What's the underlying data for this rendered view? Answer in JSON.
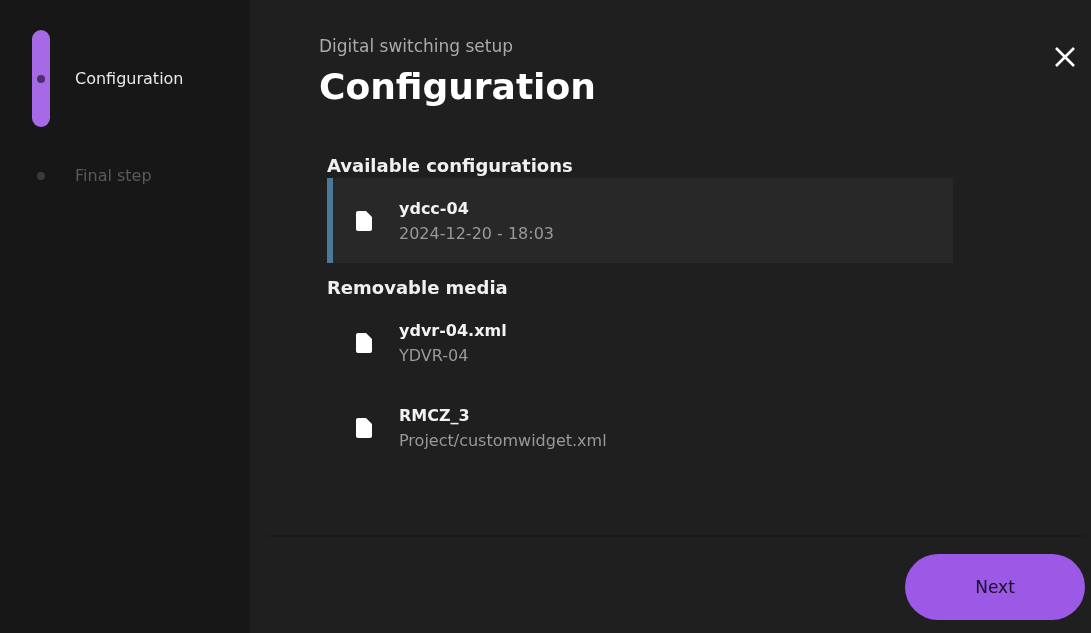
{
  "steps": [
    {
      "label": "Configuration",
      "selected": true
    },
    {
      "label": "Final step",
      "selected": false
    }
  ],
  "header": {
    "subtitle": "Digital switching setup",
    "title": "Configuration"
  },
  "sections": [
    {
      "title": "Available configurations",
      "items": [
        {
          "name": "ydcc-04",
          "detail": "2024-12-20 - 18:03",
          "selected": true
        }
      ]
    },
    {
      "title": "Removable media",
      "items": [
        {
          "name": "ydvr-04.xml",
          "detail": "YDVR-04",
          "selected": false
        },
        {
          "name": "RMCZ_3",
          "detail": "Project/customwidget.xml",
          "selected": false
        }
      ]
    }
  ],
  "buttons": {
    "next": "Next"
  }
}
